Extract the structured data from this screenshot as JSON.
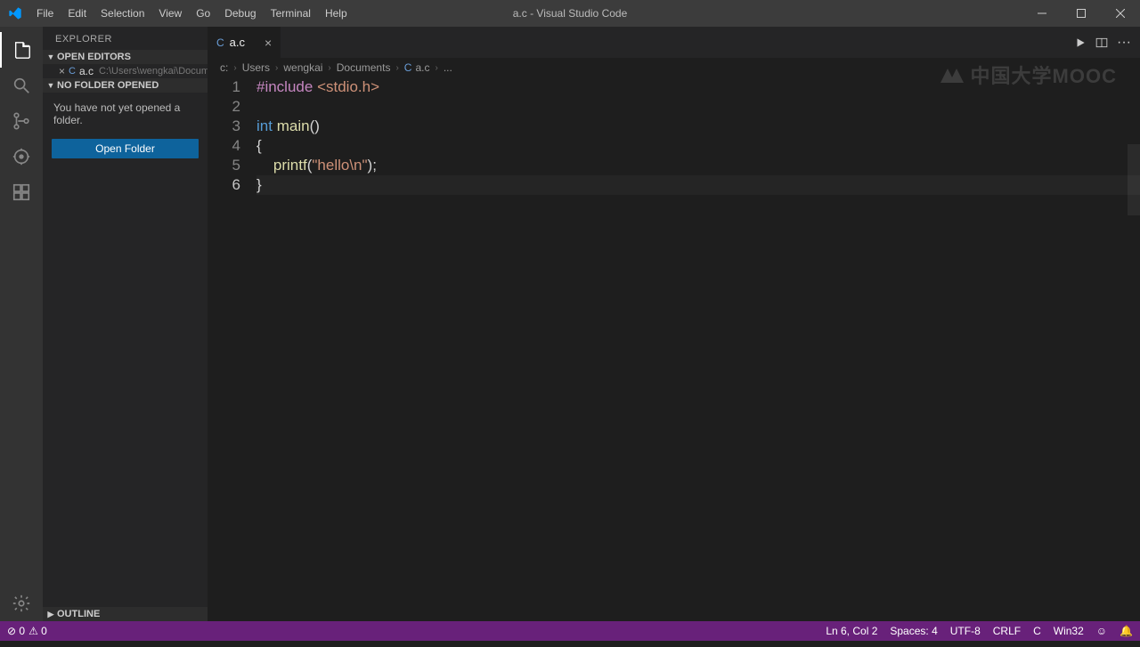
{
  "window": {
    "title": "a.c - Visual Studio Code"
  },
  "menu": {
    "items": [
      "File",
      "Edit",
      "Selection",
      "View",
      "Go",
      "Debug",
      "Terminal",
      "Help"
    ]
  },
  "activity": {
    "icons": [
      "files",
      "search",
      "source-control",
      "debug",
      "extensions"
    ]
  },
  "sidebar": {
    "title": "EXPLORER",
    "openEditors": {
      "label": "OPEN EDITORS",
      "file": {
        "lang": "C",
        "name": "a.c",
        "path": "C:\\Users\\wengkai\\Documents"
      }
    },
    "noFolder": {
      "label": "NO FOLDER OPENED",
      "message": "You have not yet opened a folder.",
      "button": "Open Folder"
    },
    "outline": {
      "label": "OUTLINE"
    }
  },
  "tab": {
    "lang": "C",
    "name": "a.c"
  },
  "breadcrumbs": {
    "segments": [
      "c:",
      "Users",
      "wengkai",
      "Documents"
    ],
    "fileLang": "C",
    "fileName": "a.c",
    "trail": "..."
  },
  "code": {
    "lines": [
      {
        "n": 1,
        "tokens": [
          [
            "directive",
            "#include"
          ],
          [
            "punct",
            " "
          ],
          [
            "string",
            "<stdio.h>"
          ]
        ]
      },
      {
        "n": 2,
        "tokens": []
      },
      {
        "n": 3,
        "tokens": [
          [
            "type",
            "int"
          ],
          [
            "punct",
            " "
          ],
          [
            "func",
            "main"
          ],
          [
            "punct",
            "()"
          ]
        ]
      },
      {
        "n": 4,
        "tokens": [
          [
            "punct",
            "{"
          ]
        ]
      },
      {
        "n": 5,
        "tokens": [
          [
            "punct",
            "    "
          ],
          [
            "func",
            "printf"
          ],
          [
            "punct",
            "("
          ],
          [
            "string",
            "\"hello\\n\""
          ],
          [
            "punct",
            ");"
          ]
        ]
      },
      {
        "n": 6,
        "current": true,
        "tokens": [
          [
            "punct",
            "}"
          ]
        ]
      }
    ]
  },
  "status": {
    "left": {
      "errors": "0",
      "warnings": "0"
    },
    "right": {
      "pos": "Ln 6, Col 2",
      "spaces": "Spaces: 4",
      "enc": "UTF-8",
      "eol": "CRLF",
      "lang": "C",
      "build": "Win32",
      "smile": "☺",
      "bell": "🔔"
    }
  },
  "watermark": "中国大学MOOC"
}
